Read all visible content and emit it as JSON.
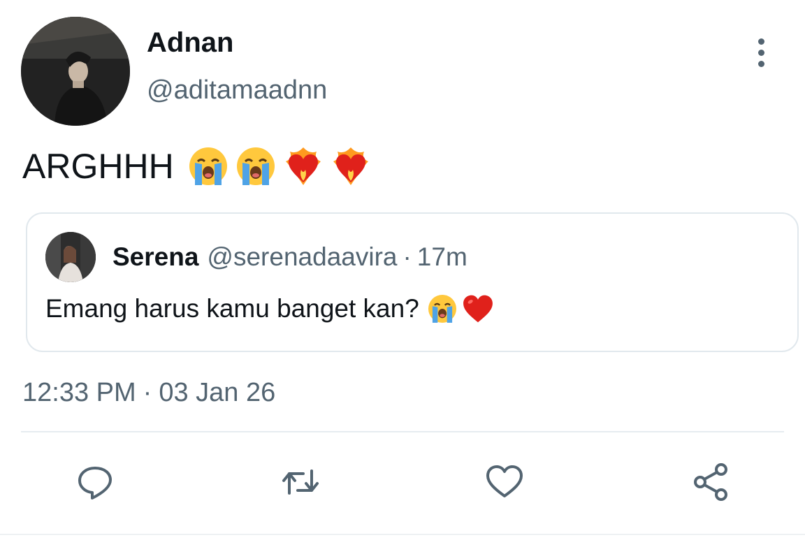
{
  "tweet": {
    "display_name": "Adnan",
    "handle": "@aditamaadnn",
    "text": "ARGHHH",
    "emojis": [
      "😭",
      "😭",
      "❤️‍🔥",
      "❤️‍🔥"
    ],
    "timestamp_time": "12:33 PM",
    "timestamp_sep": "·",
    "timestamp_date": "03 Jan 26"
  },
  "quote": {
    "display_name": "Serena",
    "handle": "@serenadaavira",
    "sep": "·",
    "time": "17m",
    "text": "Emang harus kamu banget kan?",
    "emojis": [
      "😭",
      "❤️"
    ]
  },
  "icons": {
    "more": "more-vertical-icon",
    "reply": "reply-icon",
    "retweet": "retweet-icon",
    "like": "heart-icon",
    "share": "share-icon"
  },
  "colors": {
    "text_primary": "#0f1419",
    "text_secondary": "#536471",
    "border": "#e1e8ed",
    "emoji_cry_face": "#ffc83d",
    "emoji_tears": "#4fa3e6",
    "emoji_heart": "#e0211b",
    "emoji_fire": "#ff9a1f"
  }
}
